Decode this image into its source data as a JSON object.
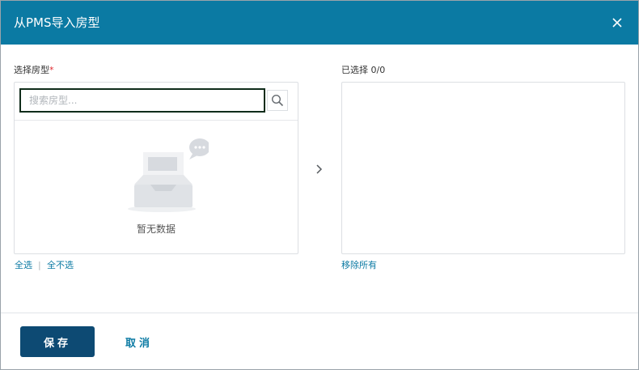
{
  "dialog": {
    "title": "从PMS导入房型",
    "close_icon": "close-icon",
    "colors": {
      "header": "#0b7aa3",
      "primary_button": "#0d4a73",
      "link": "#0b7aa3",
      "required": "#e0282e"
    }
  },
  "source": {
    "label": "选择房型",
    "required_mark": "*",
    "search": {
      "placeholder": "搜索房型...",
      "value": "",
      "icon": "search-icon"
    },
    "empty": {
      "icon": "empty-inbox-icon",
      "text": "暂无数据"
    },
    "select_all": "全选",
    "separator": "|",
    "deselect_all": "全不选"
  },
  "transfer": {
    "icon": "chevron-right-icon"
  },
  "target": {
    "label": "已选择 0/0",
    "remove_all": "移除所有"
  },
  "footer": {
    "save_label": "保存",
    "cancel_label": "取消"
  }
}
